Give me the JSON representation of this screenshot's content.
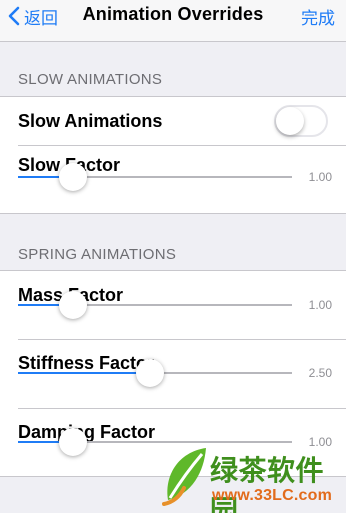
{
  "navbar": {
    "back_label": "返回",
    "title": "Animation Overrides",
    "done_label": "完成"
  },
  "sections": {
    "slow": {
      "header": "SLOW ANIMATIONS",
      "toggle_label": "Slow Animations",
      "toggle_on": false,
      "slow_factor": {
        "label": "Slow Factor",
        "value": "1.00",
        "fraction": 0.2
      }
    },
    "spring": {
      "header": "SPRING ANIMATIONS",
      "mass": {
        "label": "Mass Factor",
        "value": "1.00",
        "fraction": 0.2
      },
      "stiffness": {
        "label": "Stiffness Factor",
        "value": "2.50",
        "fraction": 0.48
      },
      "damping": {
        "label": "Damping Factor",
        "value": "1.00",
        "fraction": 0.2
      }
    }
  },
  "watermark": {
    "brand": "绿茶软件园",
    "url": "www.33LC.com"
  },
  "colors": {
    "accent": "#1f7cf6",
    "background": "#efeff4"
  }
}
